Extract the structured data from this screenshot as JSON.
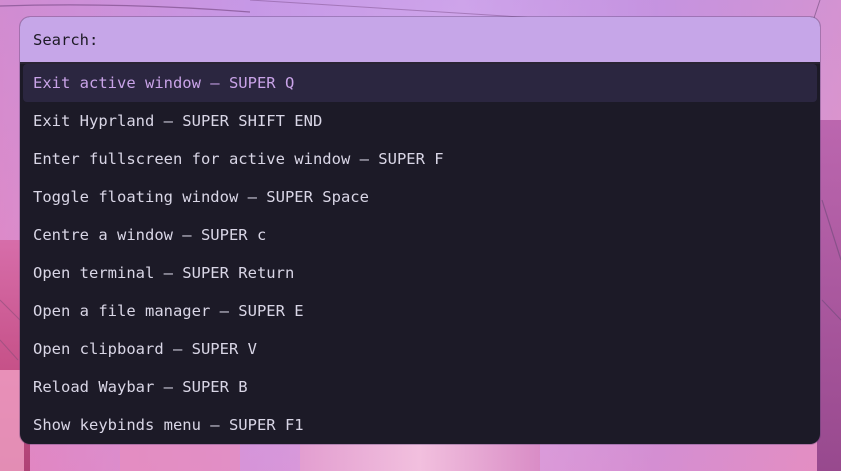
{
  "launcher": {
    "prompt": "Search:",
    "query": "",
    "selected_index": 0,
    "items": [
      "Exit active window — SUPER Q",
      "Exit Hyprland — SUPER SHIFT END",
      "Enter fullscreen for active window — SUPER F",
      "Toggle floating window — SUPER Space",
      "Centre a window — SUPER c",
      "Open terminal — SUPER Return",
      "Open a file manager — SUPER E",
      "Open clipboard — SUPER V",
      "Reload Waybar — SUPER B",
      "Show keybinds menu — SUPER F1"
    ]
  },
  "colors": {
    "search_bar_bg": "#c6a6e8",
    "list_bg": "#1c1a27",
    "selected_bg": "#2b2640",
    "selected_text": "#c9a3e8",
    "item_text": "#d9d6e6"
  }
}
